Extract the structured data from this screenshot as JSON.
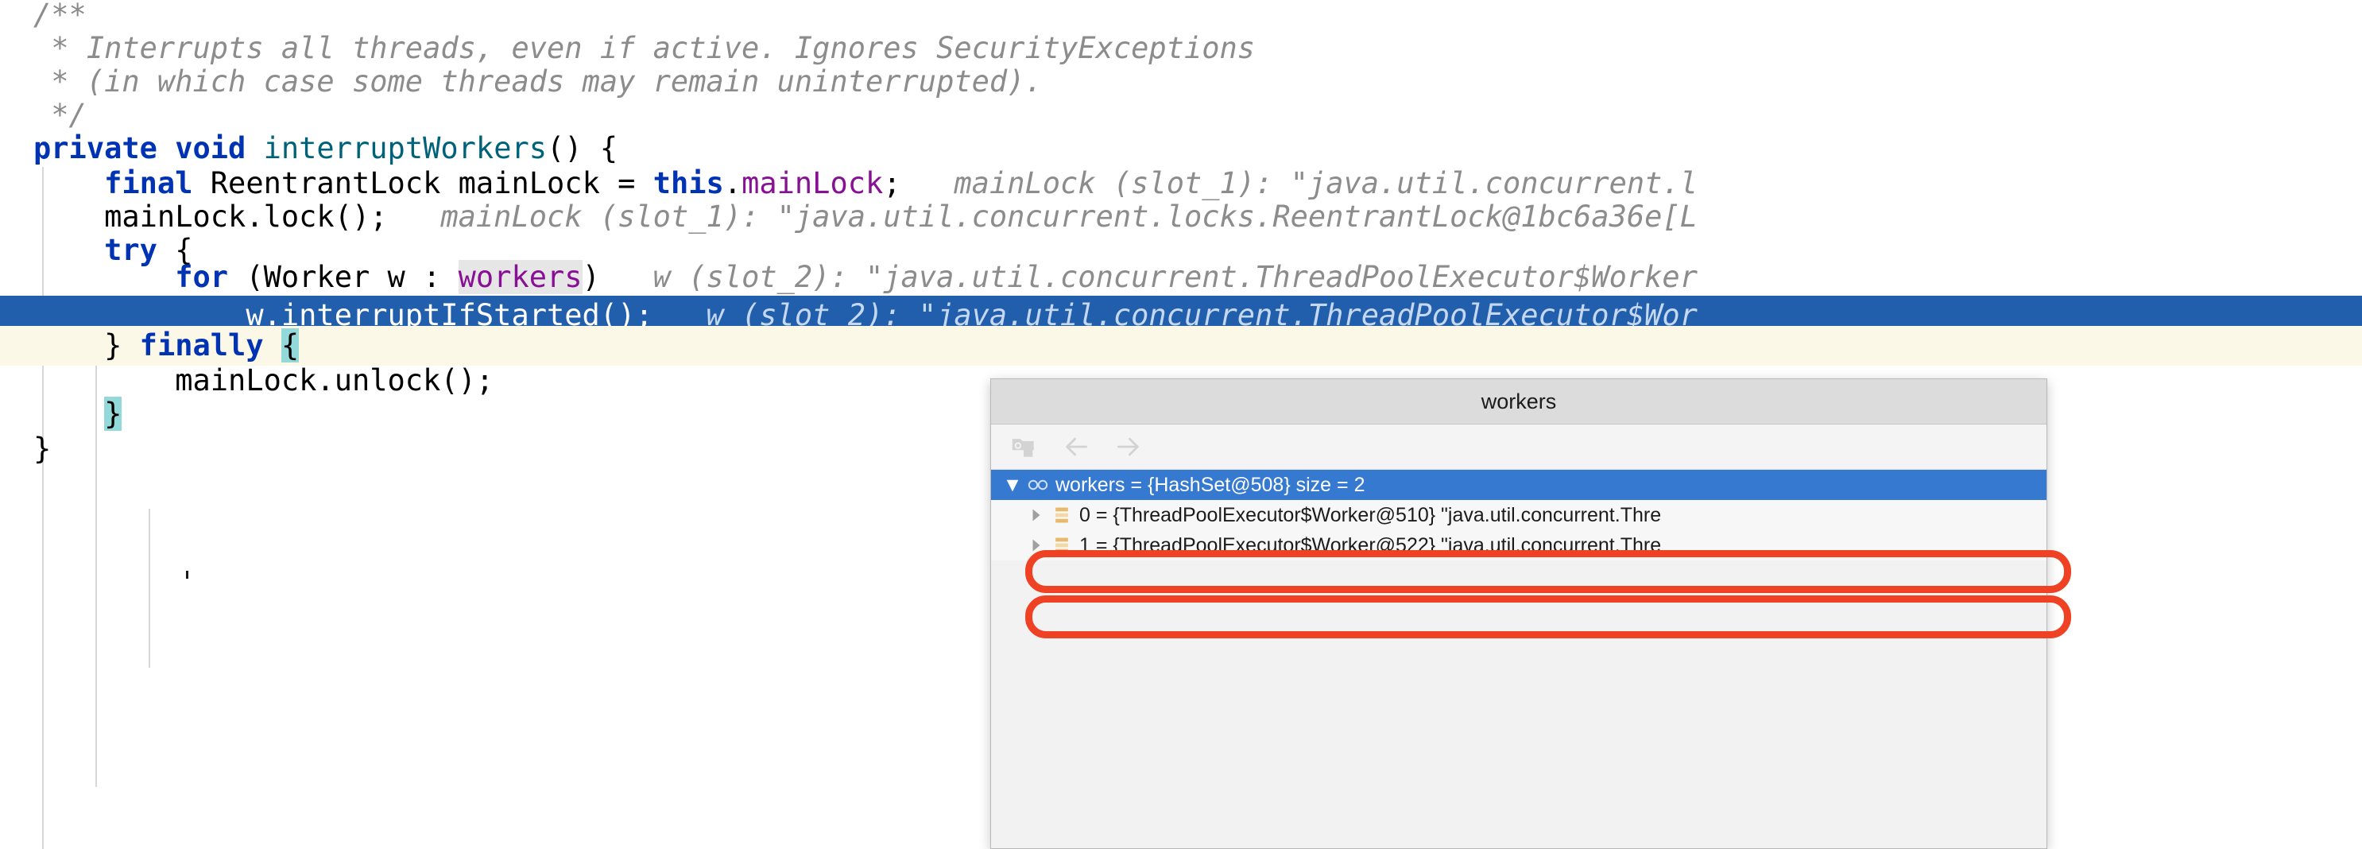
{
  "editor": {
    "language": "java",
    "colors": {
      "keyword": "#0033b3",
      "method": "#00627a",
      "field": "#871094",
      "comment": "#8c8c8c",
      "inline_hint": "#8c8c8c",
      "selected_line_bg": "#215fad",
      "cream_line_bg": "#fcf8e8",
      "brace_match_bg": "#93d9d9",
      "identifier_highlight_bg": "#e6e6e6",
      "annotation_red": "#ef4123"
    },
    "lines": [
      {
        "id": "l1",
        "indent": "",
        "tokens": [
          {
            "t": "/**",
            "c": "cmt"
          }
        ]
      },
      {
        "id": "l2",
        "indent": " ",
        "tokens": [
          {
            "t": "* Interrupts all threads, even if active. Ignores SecurityExceptions",
            "c": "cmt"
          }
        ]
      },
      {
        "id": "l3",
        "indent": " ",
        "tokens": [
          {
            "t": "* (in which case some threads may remain uninterrupted).",
            "c": "cmt"
          }
        ]
      },
      {
        "id": "l4",
        "indent": " ",
        "tokens": [
          {
            "t": "*/",
            "c": "cmt"
          }
        ]
      },
      {
        "id": "l5",
        "indent": "",
        "tokens": [
          {
            "t": "private",
            "c": "kw"
          },
          {
            "t": " ",
            "c": "plain"
          },
          {
            "t": "void",
            "c": "kw"
          },
          {
            "t": " ",
            "c": "plain"
          },
          {
            "t": "interruptWorkers",
            "c": "mth"
          },
          {
            "t": "() {",
            "c": "plain"
          }
        ]
      },
      {
        "id": "l6",
        "indent": "    ",
        "tokens": [
          {
            "t": "final",
            "c": "kw"
          },
          {
            "t": " ReentrantLock mainLock = ",
            "c": "plain"
          },
          {
            "t": "this",
            "c": "kw"
          },
          {
            "t": ".",
            "c": "plain"
          },
          {
            "t": "mainLock",
            "c": "fld"
          },
          {
            "t": ";",
            "c": "plain"
          },
          {
            "t": "   mainLock (slot_1): \"java.util.concurrent.l",
            "c": "hintx"
          }
        ]
      },
      {
        "id": "l7",
        "indent": "    ",
        "tokens": [
          {
            "t": "mainLock.lock();",
            "c": "plain"
          },
          {
            "t": "   mainLock (slot_1): \"java.util.concurrent.locks.ReentrantLock@1bc6a36e[L",
            "c": "hintx"
          }
        ]
      },
      {
        "id": "l8",
        "indent": "    ",
        "tokens": [
          {
            "t": "try",
            "c": "kw"
          },
          {
            "t": " {",
            "c": "plain"
          }
        ]
      },
      {
        "id": "l9",
        "indent": "        ",
        "tokens": [
          {
            "t": "for",
            "c": "kw"
          },
          {
            "t": " (Worker w : ",
            "c": "plain"
          },
          {
            "t": "workers",
            "c": "fld ident-hl"
          },
          {
            "t": ")",
            "c": "plain"
          },
          {
            "t": "   w (slot_2): \"java.util.concurrent.ThreadPoolExecutor$Worker",
            "c": "hintx"
          }
        ]
      },
      {
        "id": "l10",
        "indent": "            ",
        "tokens": [
          {
            "t": "w.interruptIfStarted();",
            "c": "plain"
          },
          {
            "t": "   w (slot_2): \"java.util.concurrent.ThreadPoolExecutor$Wor",
            "c": "hintx"
          }
        ]
      },
      {
        "id": "l11",
        "indent": "    ",
        "tokens": [
          {
            "t": "}",
            "c": "plain"
          },
          {
            "t": " ",
            "c": "plain"
          },
          {
            "t": "finally",
            "c": "kw"
          },
          {
            "t": " ",
            "c": "plain"
          },
          {
            "t": "{",
            "c": "plain brace-hl"
          }
        ]
      },
      {
        "id": "l12",
        "indent": "        ",
        "tokens": [
          {
            "t": "mainLock.unlock();",
            "c": "plain"
          }
        ]
      },
      {
        "id": "l13",
        "indent": "    ",
        "tokens": [
          {
            "t": "}",
            "c": "plain brace-hl"
          }
        ]
      },
      {
        "id": "l14",
        "indent": "",
        "tokens": [
          {
            "t": "}",
            "c": "plain"
          }
        ]
      }
    ]
  },
  "popup": {
    "title": "workers",
    "toolbar": {
      "items": [
        {
          "name": "inspect-object-icon",
          "label": "Inspect"
        },
        {
          "name": "arrow-left-icon",
          "label": "Back"
        },
        {
          "name": "arrow-right-icon",
          "label": "Forward"
        }
      ]
    },
    "tree": {
      "root": {
        "expander": "▼",
        "icon": "watch-glasses-icon",
        "name": "workers",
        "eq": "=",
        "value": "{HashSet@508}",
        "extra": "size = 2",
        "selected": true,
        "full_text": "workers = {HashSet@508}  size = 2"
      },
      "children": [
        {
          "expander": "▶",
          "icon": "array-element-icon",
          "index": "0",
          "eq": "=",
          "value": "{ThreadPoolExecutor$Worker@510}",
          "string": "\"java.util.concurrent.Thre",
          "annotated": true,
          "full_text": "0 = {ThreadPoolExecutor$Worker@510} \"java.util.concurrent.Thre"
        },
        {
          "expander": "▶",
          "icon": "array-element-icon",
          "index": "1",
          "eq": "=",
          "value": "{ThreadPoolExecutor$Worker@522}",
          "string": "\"java.util.concurrent.Thre",
          "annotated": true,
          "full_text": "1 = {ThreadPoolExecutor$Worker@522} \"java.util.concurrent.Thre"
        }
      ]
    }
  },
  "annotations": [
    {
      "name": "highlight-box-worker-0",
      "color": "#ef4123"
    },
    {
      "name": "highlight-box-worker-1",
      "color": "#ef4123"
    }
  ]
}
